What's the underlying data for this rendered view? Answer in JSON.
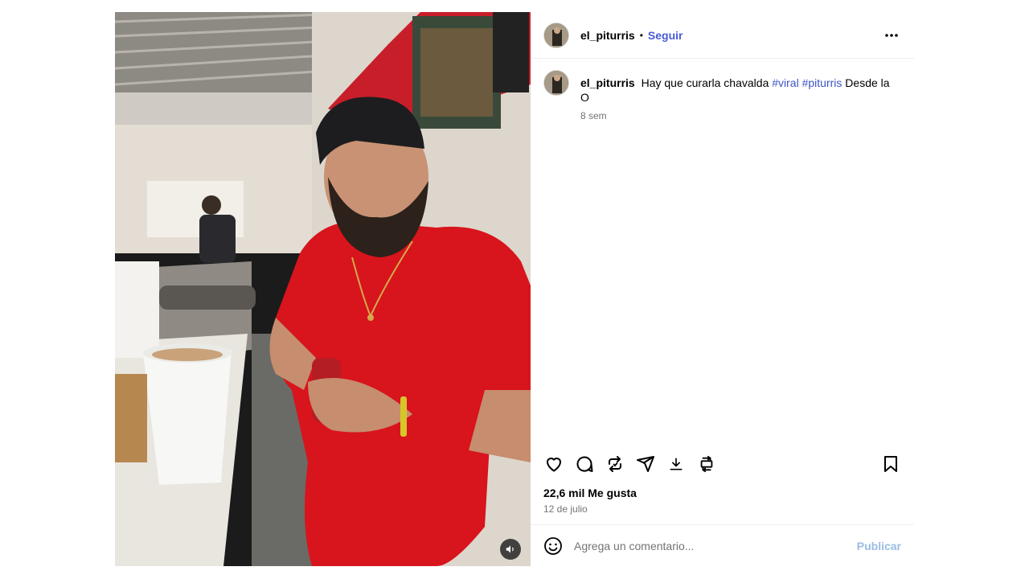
{
  "post": {
    "author": "el_piturris",
    "separator": "•",
    "follow_label": "Seguir",
    "more_icon": "more-horizontal-icon",
    "caption": {
      "username": "el_piturris",
      "text": "Hay que curarla chavalda",
      "hashtags": [
        "#viral",
        "#piturris"
      ],
      "tail": "Desde la O",
      "age": "8 sem"
    },
    "actions": {
      "like_icon": "heart-icon",
      "comment_icon": "comment-icon",
      "repost_icon": "repost-icon",
      "share_icon": "send-icon",
      "download_icon": "download-icon",
      "extra_icon": "repost-frame-icon",
      "save_icon": "bookmark-icon"
    },
    "likes": "22,6 mil Me gusta",
    "date": "12 de julio",
    "comment_box": {
      "emoji_icon": "emoji-icon",
      "placeholder": "Agrega un comentario...",
      "publish_label": "Publicar"
    },
    "media": {
      "mute_icon": "volume-icon",
      "description": "Video of a man in a red shirt and black cap inside a taco shop"
    }
  },
  "colors": {
    "follow": "#4a5bd6",
    "hashtag": "#3d54c4",
    "muted_text": "#737373",
    "publish_disabled": "#9bbce3",
    "shirt": "#d8141c"
  }
}
